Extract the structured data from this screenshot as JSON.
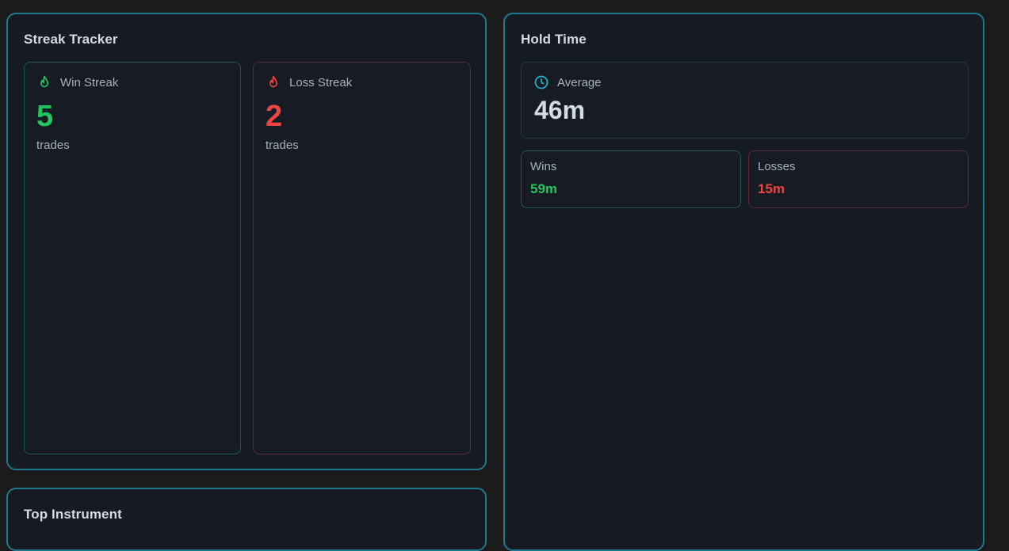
{
  "streak_tracker": {
    "title": "Streak Tracker",
    "win": {
      "label": "Win Streak",
      "value": "5",
      "unit": "trades",
      "icon": "flame-icon",
      "color": "#22c55e"
    },
    "loss": {
      "label": "Loss Streak",
      "value": "2",
      "unit": "trades",
      "icon": "flame-icon",
      "color": "#ef4444"
    }
  },
  "hold_time": {
    "title": "Hold Time",
    "average": {
      "label": "Average",
      "value": "46m",
      "icon": "clock-icon",
      "color": "#22b8cf"
    },
    "wins": {
      "label": "Wins",
      "value": "59m",
      "color": "#22c55e"
    },
    "losses": {
      "label": "Losses",
      "value": "15m",
      "color": "#ef4444"
    }
  },
  "top_instrument": {
    "title": "Top Instrument"
  },
  "colors": {
    "background": "#1b1b1c",
    "card": "#161a22",
    "card_border": "#1d7a8f"
  }
}
